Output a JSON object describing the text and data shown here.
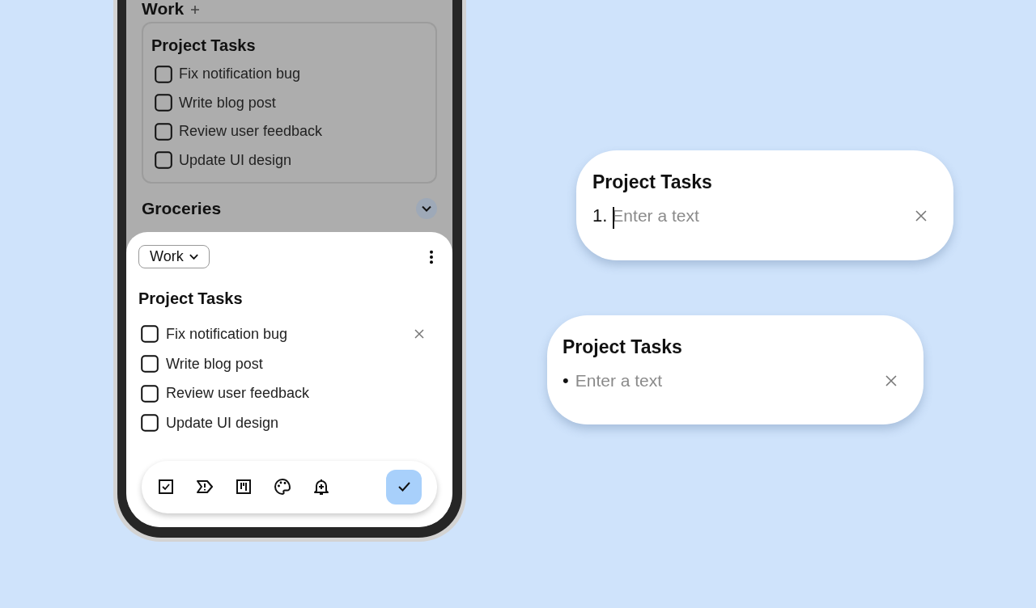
{
  "background_list": {
    "header": {
      "title": "Work"
    },
    "card": {
      "title": "Project Tasks",
      "items": [
        {
          "text": "Fix notification bug",
          "checked": false
        },
        {
          "text": "Write blog post",
          "checked": false
        },
        {
          "text": "Review user feedback",
          "checked": false
        },
        {
          "text": "Update UI design",
          "checked": false
        }
      ]
    },
    "next_section": {
      "title": "Groceries",
      "expanded": false
    }
  },
  "sheet": {
    "category": "Work",
    "title": "Project Tasks",
    "items": [
      {
        "text": "Fix notification bug",
        "checked": false,
        "removable": true
      },
      {
        "text": "Write blog post",
        "checked": false,
        "removable": false
      },
      {
        "text": "Review user feedback",
        "checked": false,
        "removable": false
      },
      {
        "text": "Update UI design",
        "checked": false,
        "removable": false
      }
    ]
  },
  "previews": [
    {
      "title": "Project Tasks",
      "kind": "numbered",
      "marker": "1.",
      "placeholder": "Enter a text",
      "focused": true
    },
    {
      "title": "Project Tasks",
      "kind": "bulleted",
      "marker": "•",
      "placeholder": "Enter a text",
      "focused": false
    }
  ]
}
